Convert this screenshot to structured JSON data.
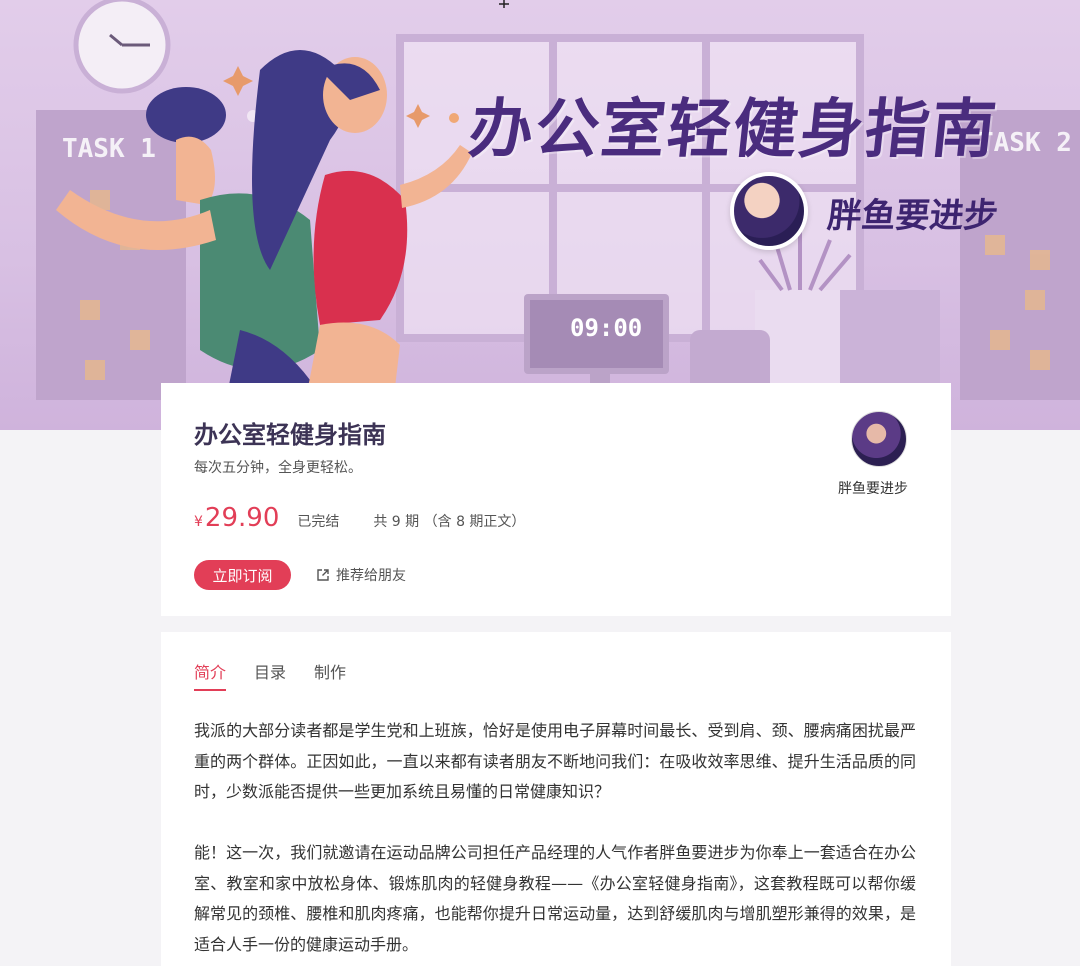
{
  "hero": {
    "title": "办公室轻健身指南",
    "author": "胖鱼要进步",
    "task1": "TASK 1",
    "task2": "TASK 2",
    "clock_time": "09:00"
  },
  "info": {
    "title": "办公室轻健身指南",
    "subtitle": "每次五分钟，全身更轻松。",
    "price_currency": "¥",
    "price": "29.90",
    "status": "已完结",
    "episodes": "共 9 期 （含 8 期正文）",
    "subscribe_label": "立即订阅",
    "share_label": "推荐给朋友",
    "author_name": "胖鱼要进步"
  },
  "tabs": [
    {
      "label": "简介",
      "active": true
    },
    {
      "label": "目录",
      "active": false
    },
    {
      "label": "制作",
      "active": false
    }
  ],
  "intro": {
    "paragraphs": [
      "我派的大部分读者都是学生党和上班族，恰好是使用电子屏幕时间最长、受到肩、颈、腰病痛困扰最严重的两个群体。正因如此，一直以来都有读者朋友不断地问我们：在吸收效率思维、提升生活品质的同时，少数派能否提供一些更加系统且易懂的日常健康知识？",
      "能！这一次，我们就邀请在运动品牌公司担任产品经理的人气作者胖鱼要进步为你奉上一套适合在办公室、教室和家中放松身体、锻炼肌肉的轻健身教程——《办公室轻健身指南》，这套教程既可以帮你缓解常见的颈椎、腰椎和肌肉疼痛，也能帮你提升日常运动量，达到舒缓肌肉与增肌塑形兼得的效果，是适合人手一份的健康运动手册。"
    ]
  },
  "colors": {
    "accent": "#e23e57",
    "hero_title": "#4a2c7e",
    "hero_bg": "#dcc6e6"
  }
}
